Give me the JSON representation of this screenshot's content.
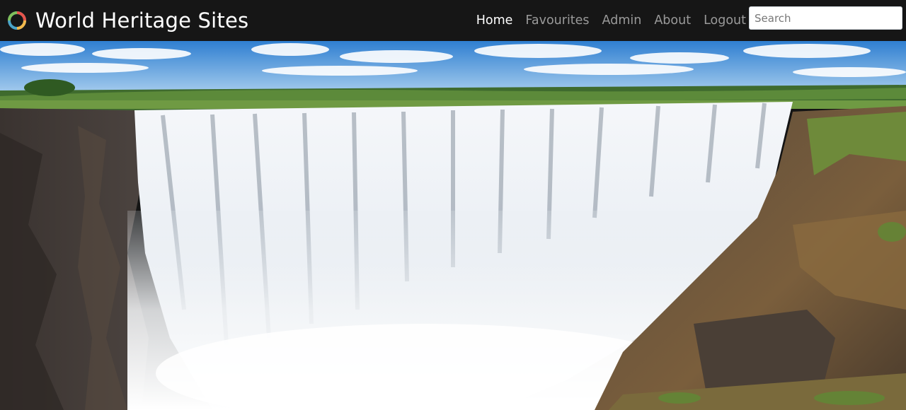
{
  "brand": {
    "title": "World Heritage Sites",
    "logo_icon": "circular-logo-icon"
  },
  "nav": {
    "items": [
      {
        "label": "Home",
        "active": true
      },
      {
        "label": "Favourites",
        "active": false
      },
      {
        "label": "Admin",
        "active": false
      },
      {
        "label": "About",
        "active": false
      },
      {
        "label": "Logout",
        "active": false
      }
    ]
  },
  "search": {
    "placeholder": "Search",
    "value": ""
  },
  "hero": {
    "image_icon": "waterfall-hero-image"
  },
  "colors": {
    "navbar_bg": "#161616",
    "nav_active": "#ffffff",
    "nav_inactive": "#9a9a9a",
    "logo_ring_a": "#e7544b",
    "logo_ring_b": "#4aa3c8",
    "logo_ring_c": "#f2b84b"
  }
}
